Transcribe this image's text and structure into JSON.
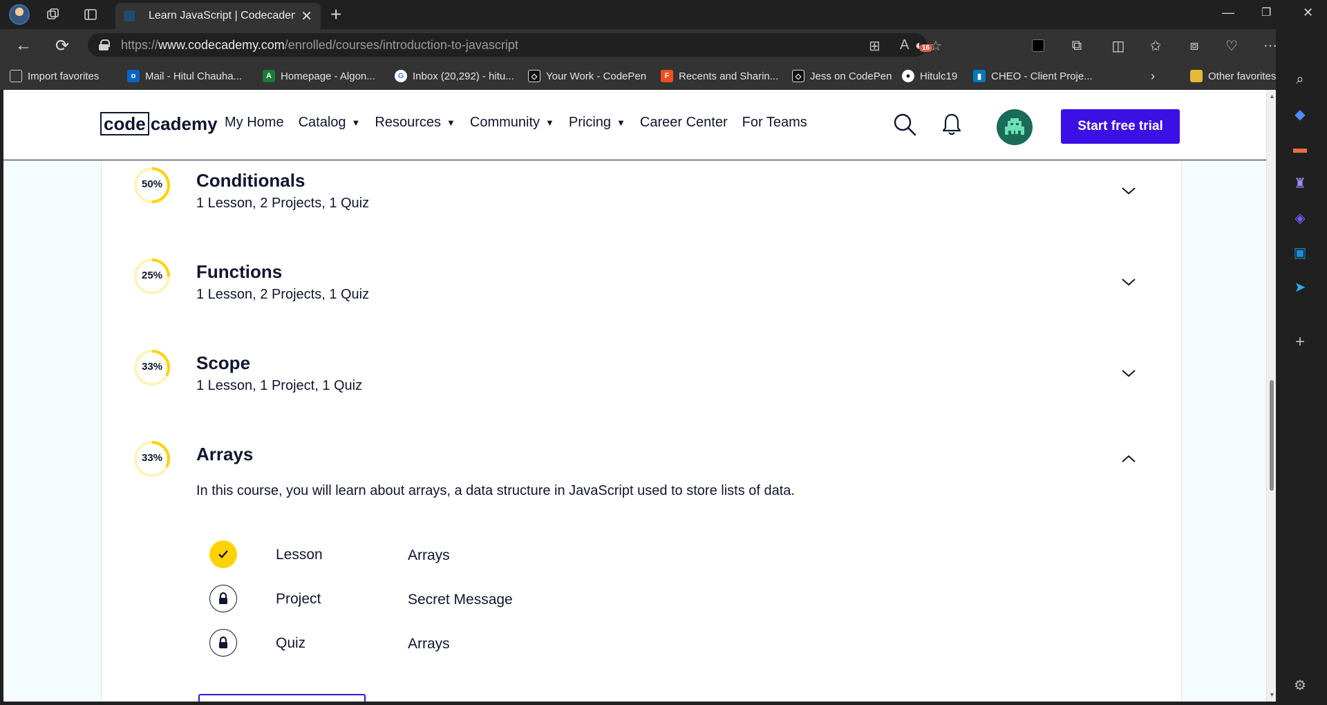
{
  "browser": {
    "tab_title": "Learn JavaScript | Codecademy",
    "url_prefix": "https://",
    "url_domain": "www.codecademy.com",
    "url_path": "/enrolled/courses/introduction-to-javascript",
    "extensions_badge": "16",
    "favorites": [
      {
        "label": "Import favorites",
        "icon": "import-icon",
        "color": "#3a3a3a"
      },
      {
        "label": "Mail - Hitul Chauha...",
        "icon": "outlook-icon",
        "color": "#0a64c8"
      },
      {
        "label": "Homepage - Algon...",
        "icon": "algonquin-icon",
        "color": "#1a7a3c"
      },
      {
        "label": "Inbox (20,292) - hitu...",
        "icon": "google-icon",
        "color": "#ffffff"
      },
      {
        "label": "Your Work - CodePen",
        "icon": "codepen-icon",
        "color": "#111111"
      },
      {
        "label": "Recents and Sharin...",
        "icon": "figma-icon",
        "color": "#f24e1e"
      },
      {
        "label": "Jess on CodePen",
        "icon": "codepen-icon",
        "color": "#111111"
      },
      {
        "label": "Hitulc19",
        "icon": "github-icon",
        "color": "#111111"
      },
      {
        "label": "CHEO - Client Proje...",
        "icon": "trello-icon",
        "color": "#0079bf"
      }
    ],
    "other_favorites": "Other favorites"
  },
  "site": {
    "logo_box": "code",
    "logo_rest": "cademy",
    "nav": [
      {
        "label": "My Home",
        "caret": false
      },
      {
        "label": "Catalog",
        "caret": true
      },
      {
        "label": "Resources",
        "caret": true
      },
      {
        "label": "Community",
        "caret": true
      },
      {
        "label": "Pricing",
        "caret": true
      },
      {
        "label": "Career Center",
        "caret": false
      },
      {
        "label": "For Teams",
        "caret": false
      }
    ],
    "cta": "Start free trial"
  },
  "modules": [
    {
      "title": "Conditionals",
      "subtitle": "1 Lesson, 2 Projects, 1 Quiz",
      "progress_label": "50%",
      "progress": 0.5,
      "expanded": false
    },
    {
      "title": "Functions",
      "subtitle": "1 Lesson, 2 Projects, 1 Quiz",
      "progress_label": "25%",
      "progress": 0.25,
      "expanded": false
    },
    {
      "title": "Scope",
      "subtitle": "1 Lesson, 1 Project, 1 Quiz",
      "progress_label": "33%",
      "progress": 0.33,
      "expanded": false
    },
    {
      "title": "Arrays",
      "description": "In this course, you will learn about arrays, a data structure in JavaScript used to store lists of data.",
      "progress_label": "33%",
      "progress": 0.33,
      "expanded": true,
      "items": [
        {
          "type": "Lesson",
          "name": "Arrays",
          "status": "done"
        },
        {
          "type": "Project",
          "name": "Secret Message",
          "status": "locked"
        },
        {
          "type": "Quiz",
          "name": "Arrays",
          "status": "locked"
        }
      ]
    }
  ],
  "colors": {
    "accent": "#3a10e5",
    "progress": "#ffd300",
    "progress_track": "#fff3b8",
    "ink": "#10162f"
  }
}
